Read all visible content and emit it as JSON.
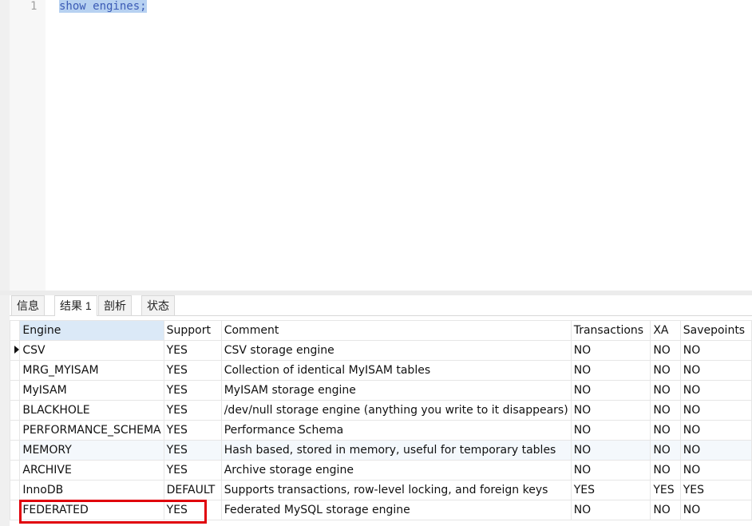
{
  "editor": {
    "line_number": "1",
    "query": "show engines;"
  },
  "tabs": [
    {
      "label": "信息"
    },
    {
      "label": "结果 1"
    },
    {
      "label": "剖析"
    },
    {
      "label": "状态"
    }
  ],
  "grid": {
    "columns": [
      "Engine",
      "Support",
      "Comment",
      "Transactions",
      "XA",
      "Savepoints"
    ],
    "rows": [
      [
        "CSV",
        "YES",
        "CSV storage engine",
        "NO",
        "NO",
        "NO"
      ],
      [
        "MRG_MYISAM",
        "YES",
        "Collection of identical MyISAM tables",
        "NO",
        "NO",
        "NO"
      ],
      [
        "MyISAM",
        "YES",
        "MyISAM storage engine",
        "NO",
        "NO",
        "NO"
      ],
      [
        "BLACKHOLE",
        "YES",
        "/dev/null storage engine (anything you write to it disappears)",
        "NO",
        "NO",
        "NO"
      ],
      [
        "PERFORMANCE_SCHEMA",
        "YES",
        "Performance Schema",
        "NO",
        "NO",
        "NO"
      ],
      [
        "MEMORY",
        "YES",
        "Hash based, stored in memory, useful for temporary tables",
        "NO",
        "NO",
        "NO"
      ],
      [
        "ARCHIVE",
        "YES",
        "Archive storage engine",
        "NO",
        "NO",
        "NO"
      ],
      [
        "InnoDB",
        "DEFAULT",
        "Supports transactions, row-level locking, and foreign keys",
        "YES",
        "YES",
        "YES"
      ],
      [
        "FEDERATED",
        "YES",
        "Federated MySQL storage engine",
        "NO",
        "NO",
        "NO"
      ]
    ]
  },
  "colors": {
    "selection": "#b7d1f1",
    "sorted_header": "#dbe9f7",
    "highlight": "#e0000a"
  }
}
